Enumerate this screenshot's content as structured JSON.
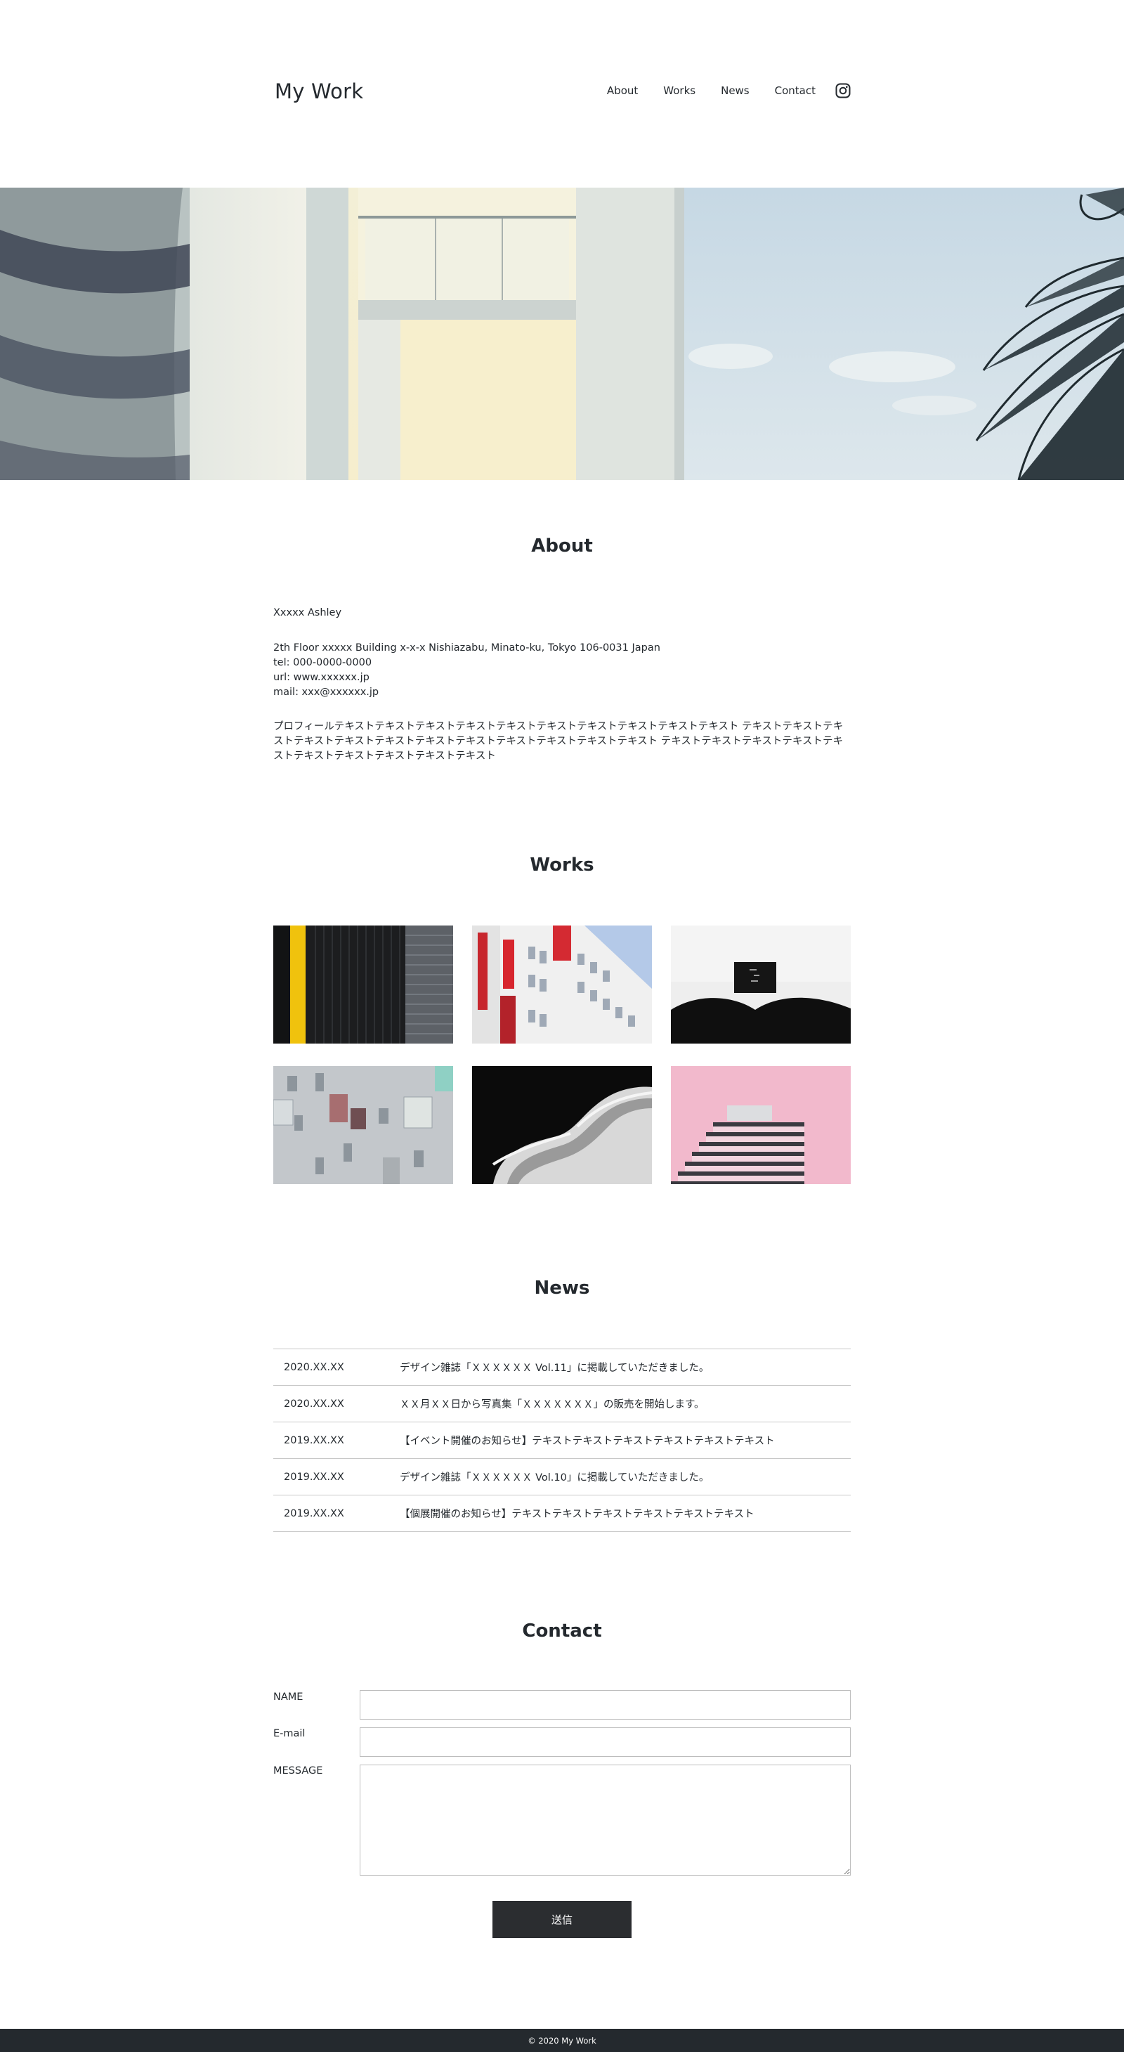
{
  "header": {
    "logo": "My Work",
    "nav": [
      "About",
      "Works",
      "News",
      "Contact"
    ],
    "instagram_icon": "instagram-icon"
  },
  "about": {
    "title": "About",
    "name": "Xxxxx Ashley",
    "address": "2th Floor xxxxx Building x-x-x Nishiazabu, Minato-ku, Tokyo 106-0031 Japan",
    "tel": "tel: 000-0000-0000",
    "url": "url: www.xxxxxx.jp",
    "mail": "mail: xxx@xxxxxx.jp",
    "profile": "プロフィールテキストテキストテキストテキストテキストテキストテキストテキストテキストテキスト テキストテキストテキストテキストテキストテキストテキストテキストテキストテキストテキストテキスト テキストテキストテキストテキストテキストテキストテキストテキストテキストテキスト"
  },
  "works": {
    "title": "Works",
    "items": [
      "work-black-wall-yellow-stripe",
      "work-red-white-building",
      "work-white-curve-bench",
      "work-grey-facade-windows",
      "work-curved-balconies",
      "work-pink-tower"
    ]
  },
  "news": {
    "title": "News",
    "items": [
      {
        "date": "2020.XX.XX",
        "text": "デザイン雑誌「ＸＸＸＸＸＸ Vol.11」に掲載していただきました。"
      },
      {
        "date": "2020.XX.XX",
        "text": "ＸＸ月ＸＸ日から写真集「ＸＸＸＸＸＸＸ」の販売を開始します。"
      },
      {
        "date": "2019.XX.XX",
        "text": "【イベント開催のお知らせ】テキストテキストテキストテキストテキストテキスト"
      },
      {
        "date": "2019.XX.XX",
        "text": "デザイン雑誌「ＸＸＸＸＸＸ Vol.10」に掲載していただきました。"
      },
      {
        "date": "2019.XX.XX",
        "text": "【個展開催のお知らせ】テキストテキストテキストテキストテキストテキスト"
      }
    ]
  },
  "contact": {
    "title": "Contact",
    "name_label": "NAME",
    "email_label": "E-mail",
    "message_label": "MESSAGE",
    "submit_label": "送信"
  },
  "footer": {
    "copyright": "© 2020 My Work"
  },
  "colors": {
    "text": "#24292e",
    "footer_bg": "#24292e",
    "button_bg": "#2b2d30",
    "border": "#c8c8c8"
  }
}
